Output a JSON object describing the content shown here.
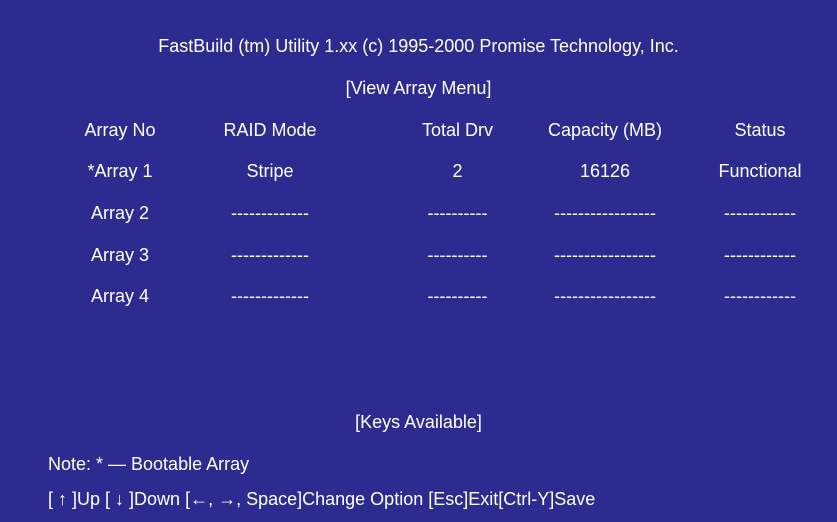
{
  "header": {
    "title": "FastBuild (tm) Utility 1.xx (c) 1995-2000 Promise Technology, Inc.",
    "menu": "[View Array Menu]"
  },
  "table": {
    "columns": [
      "Array No",
      "RAID Mode",
      "Total Drv",
      "Capacity (MB)",
      "Status"
    ],
    "rows": [
      [
        "*Array 1",
        "Stripe",
        "2",
        "16126",
        "Functional"
      ],
      [
        "Array 2",
        "-------------",
        "----------",
        "-----------------",
        "------------"
      ],
      [
        "Array 3",
        "-------------",
        "----------",
        "-----------------",
        "------------"
      ],
      [
        "Array 4",
        "-------------",
        "----------",
        "-----------------",
        "------------"
      ]
    ]
  },
  "footer": {
    "keys_title": "[Keys Available]",
    "note": "Note: * — Bootable Array",
    "keys": {
      "up": "[ ↑ ]Up",
      "down": "[ ↓ ]Down",
      "change": "[←, →, Space]Change Option",
      "esc": "[Esc]Exit",
      "save": "[Ctrl-Y]Save"
    }
  },
  "colors": {
    "background": "#2c2b90",
    "text": "#ffffff"
  }
}
